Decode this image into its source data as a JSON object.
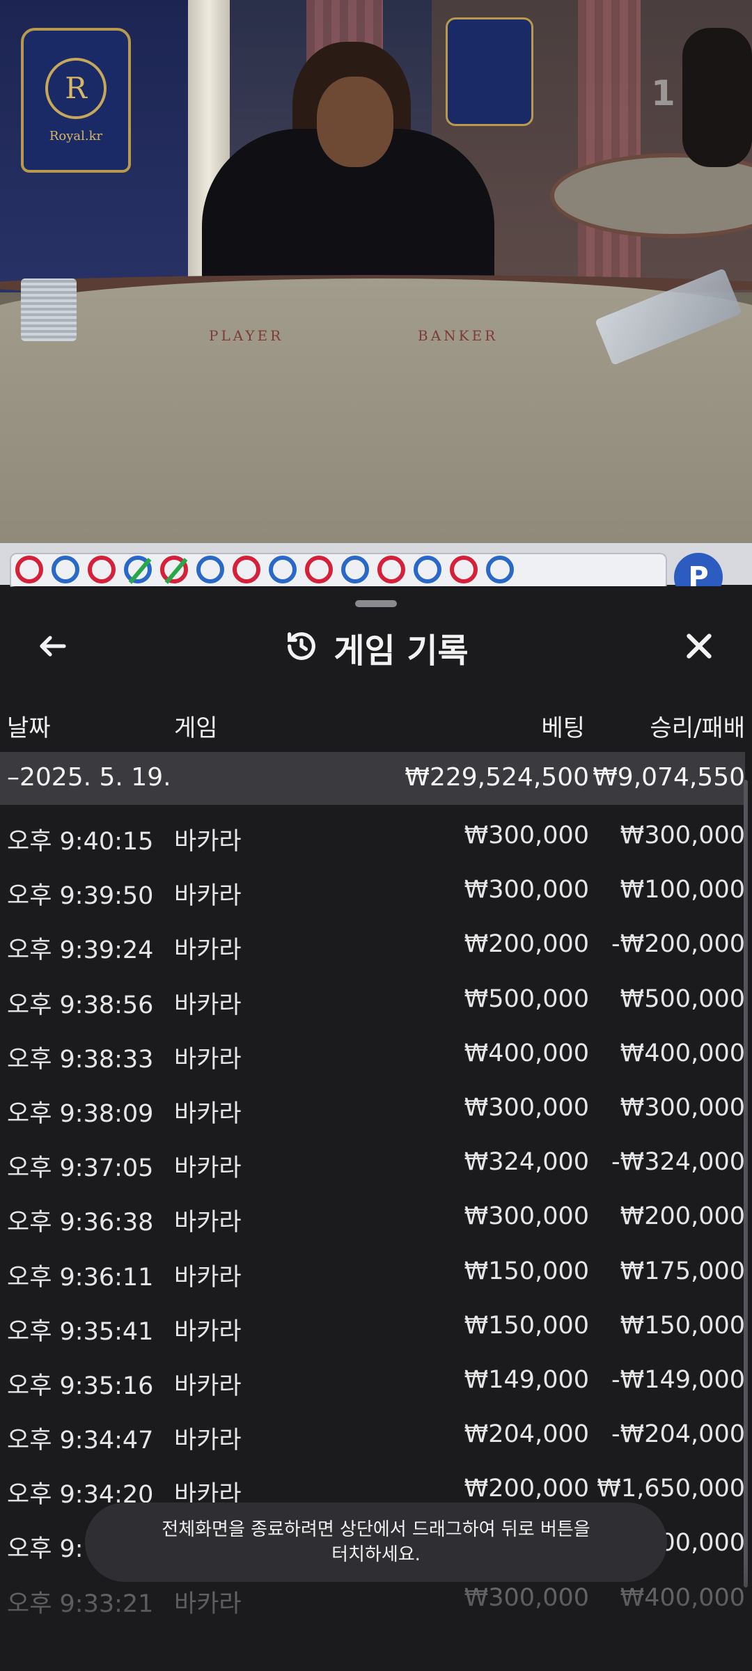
{
  "video": {
    "logo_text": "Royal.kr",
    "logo_letter": "R",
    "table_player": "PLAYER",
    "table_banker": "BANKER",
    "corner_number": "1"
  },
  "road": {
    "beads": [
      "red-dot",
      "blue",
      "red",
      "blue-slash",
      "red-slash",
      "blue",
      "red",
      "blue-dot",
      "red-dot",
      "blue-dot",
      "red",
      "blue",
      "red",
      "blue"
    ],
    "bp_label": "P"
  },
  "header": {
    "title": "게임 기록",
    "back_icon": "arrow-left-icon",
    "history_icon": "history-icon",
    "close_icon": "close-icon"
  },
  "columns": {
    "date": "날짜",
    "game": "게임",
    "bet": "베팅",
    "winloss": "승리/패배"
  },
  "summary": {
    "date": "–2025. 5. 19.",
    "bet": "₩229,524,500",
    "winloss": "₩9,074,550"
  },
  "rows": [
    {
      "time": "오후 9:40:15",
      "game": "바카라",
      "bet": "₩300,000",
      "winloss": "₩300,000"
    },
    {
      "time": "오후 9:39:50",
      "game": "바카라",
      "bet": "₩300,000",
      "winloss": "₩100,000"
    },
    {
      "time": "오후 9:39:24",
      "game": "바카라",
      "bet": "₩200,000",
      "winloss": "-₩200,000"
    },
    {
      "time": "오후 9:38:56",
      "game": "바카라",
      "bet": "₩500,000",
      "winloss": "₩500,000"
    },
    {
      "time": "오후 9:38:33",
      "game": "바카라",
      "bet": "₩400,000",
      "winloss": "₩400,000"
    },
    {
      "time": "오후 9:38:09",
      "game": "바카라",
      "bet": "₩300,000",
      "winloss": "₩300,000"
    },
    {
      "time": "오후 9:37:05",
      "game": "바카라",
      "bet": "₩324,000",
      "winloss": "-₩324,000"
    },
    {
      "time": "오후 9:36:38",
      "game": "바카라",
      "bet": "₩300,000",
      "winloss": "₩200,000"
    },
    {
      "time": "오후 9:36:11",
      "game": "바카라",
      "bet": "₩150,000",
      "winloss": "₩175,000"
    },
    {
      "time": "오후 9:35:41",
      "game": "바카라",
      "bet": "₩150,000",
      "winloss": "₩150,000"
    },
    {
      "time": "오후 9:35:16",
      "game": "바카라",
      "bet": "₩149,000",
      "winloss": "-₩149,000"
    },
    {
      "time": "오후 9:34:47",
      "game": "바카라",
      "bet": "₩204,000",
      "winloss": "-₩204,000"
    },
    {
      "time": "오후 9:34:20",
      "game": "바카라",
      "bet": "₩200,000",
      "winloss": "₩1,650,000"
    },
    {
      "time": "오후 9:",
      "game": "",
      "bet": "",
      "winloss": "00,000"
    },
    {
      "time": "오후 9:33:21",
      "game": "바카라",
      "bet": "₩300,000",
      "winloss": "₩400,000"
    }
  ],
  "toast": {
    "line1": "전체화면을 종료하려면 상단에서 드래그하여 뒤로 버튼을",
    "line2": "터치하세요."
  }
}
